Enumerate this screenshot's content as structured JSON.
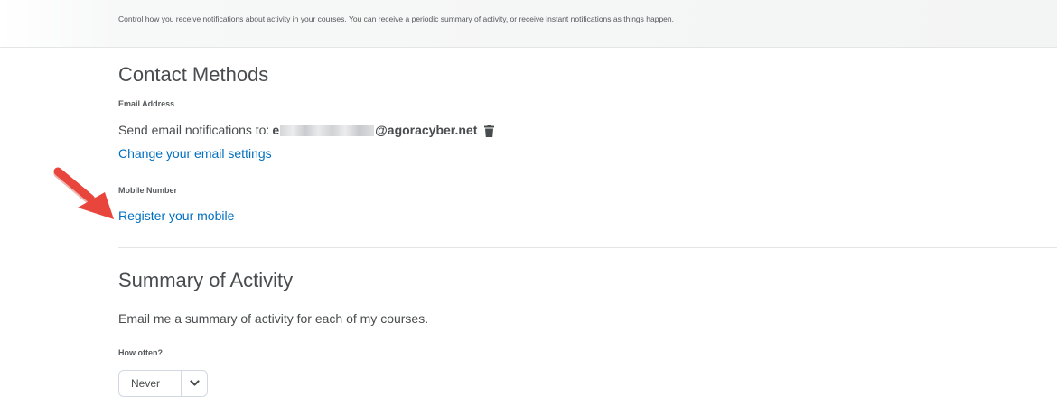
{
  "intro": "Control how you receive notifications about activity in your courses. You can receive a periodic summary of activity, or receive instant notifications as things happen.",
  "contact": {
    "heading": "Contact Methods",
    "email_label": "Email Address",
    "send_text": "Send email notifications to:",
    "email_prefix": "e",
    "email_domain": "@agoracyber.net",
    "change_link": "Change your email settings",
    "mobile_label": "Mobile Number",
    "register_link": "Register your mobile"
  },
  "summary": {
    "heading": "Summary of Activity",
    "description": "Email me a summary of activity for each of my courses.",
    "frequency_label": "How often?",
    "frequency_value": "Never"
  },
  "colors": {
    "link": "#006fbf",
    "arrow": "#e8453c",
    "text": "#494c4e"
  },
  "icons": {
    "delete": "trash-icon",
    "dropdown": "chevron-down-icon",
    "annotation": "red-arrow"
  }
}
